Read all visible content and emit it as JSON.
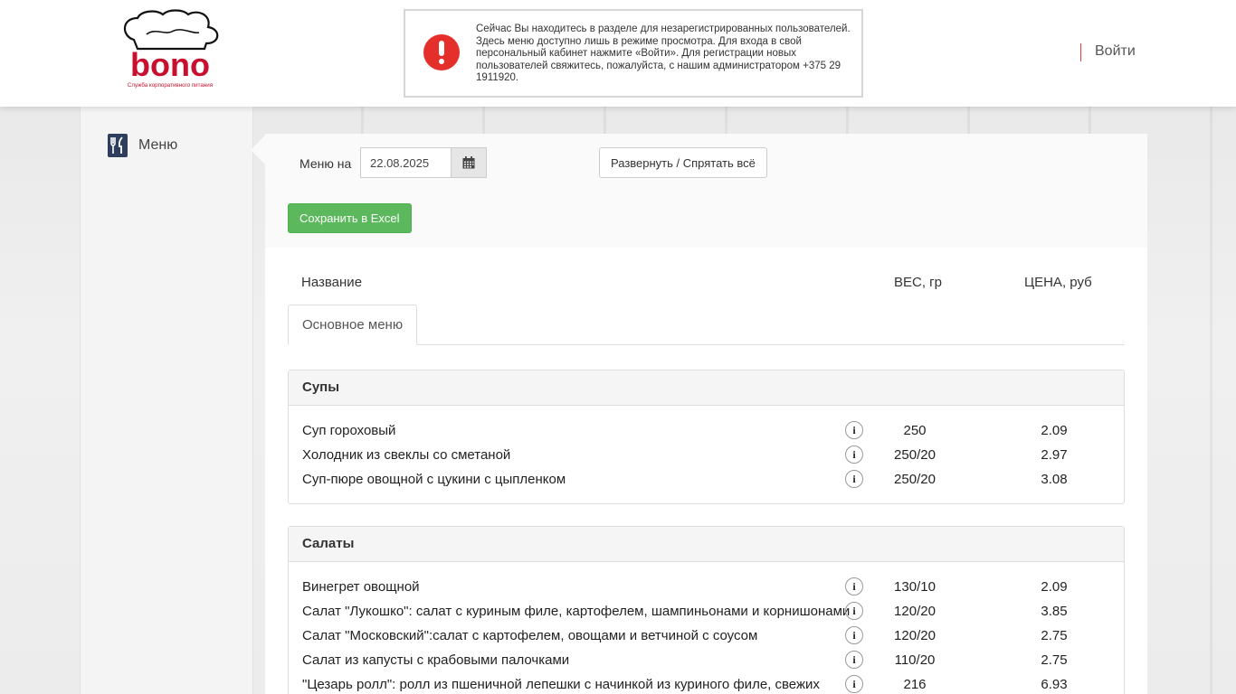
{
  "header": {
    "logo_text": "bono",
    "logo_subtitle": "Служба корпоративного питания",
    "notice": "Сейчас Вы находитесь в разделе для незарегистрированных пользователей. Здесь меню доступно лишь в режиме просмотра. Для входа в свой персональный кабинет нажмите «Войти». Для регистрации новых пользователей свяжитесь, пожалуйста, с нашим администратором +375 29 1911920.",
    "login_label": "Войти"
  },
  "sidebar": {
    "items": [
      {
        "label": "Меню",
        "icon": "fork-knife-icon"
      }
    ]
  },
  "toolbar": {
    "date_label": "Меню на",
    "date_value": "22.08.2025",
    "expand_label": "Развернуть / Спрятать всё",
    "excel_label": "Сохранить в Excel"
  },
  "columns": {
    "name": "Название",
    "weight": "ВЕС, гр",
    "price": "ЦЕНА, руб"
  },
  "tabs": [
    {
      "label": "Основное меню",
      "active": true
    }
  ],
  "sections": [
    {
      "title": "Супы",
      "items": [
        {
          "name": "Суп гороховый",
          "weight": "250",
          "price": "2.09"
        },
        {
          "name": "Холодник из свеклы со сметаной",
          "weight": "250/20",
          "price": "2.97"
        },
        {
          "name": "Суп-пюре овощной с цукини с цыпленком",
          "weight": "250/20",
          "price": "3.08"
        }
      ]
    },
    {
      "title": "Салаты",
      "items": [
        {
          "name": "Винегрет овощной",
          "weight": "130/10",
          "price": "2.09"
        },
        {
          "name": "Салат \"Лукошко\": салат с куриным филе, картофелем, шампиньонами и корнишонами",
          "weight": "120/20",
          "price": "3.85"
        },
        {
          "name": "Салат \"Московский\":салат с картофелем, овощами и ветчиной с соусом",
          "weight": "120/20",
          "price": "2.75"
        },
        {
          "name": "Салат из капусты с крабовыми палочками",
          "weight": "110/20",
          "price": "2.75"
        },
        {
          "name": "\"Цезарь ролл\": ролл из пшеничной лепешки с начинкой из куриного филе, свежих",
          "weight": "216",
          "price": "6.93"
        }
      ]
    }
  ],
  "info_glyph": "i",
  "colors": {
    "accent_red": "#c8102e",
    "alert_red": "#e52f2a",
    "excel_green": "#5cb85c"
  }
}
